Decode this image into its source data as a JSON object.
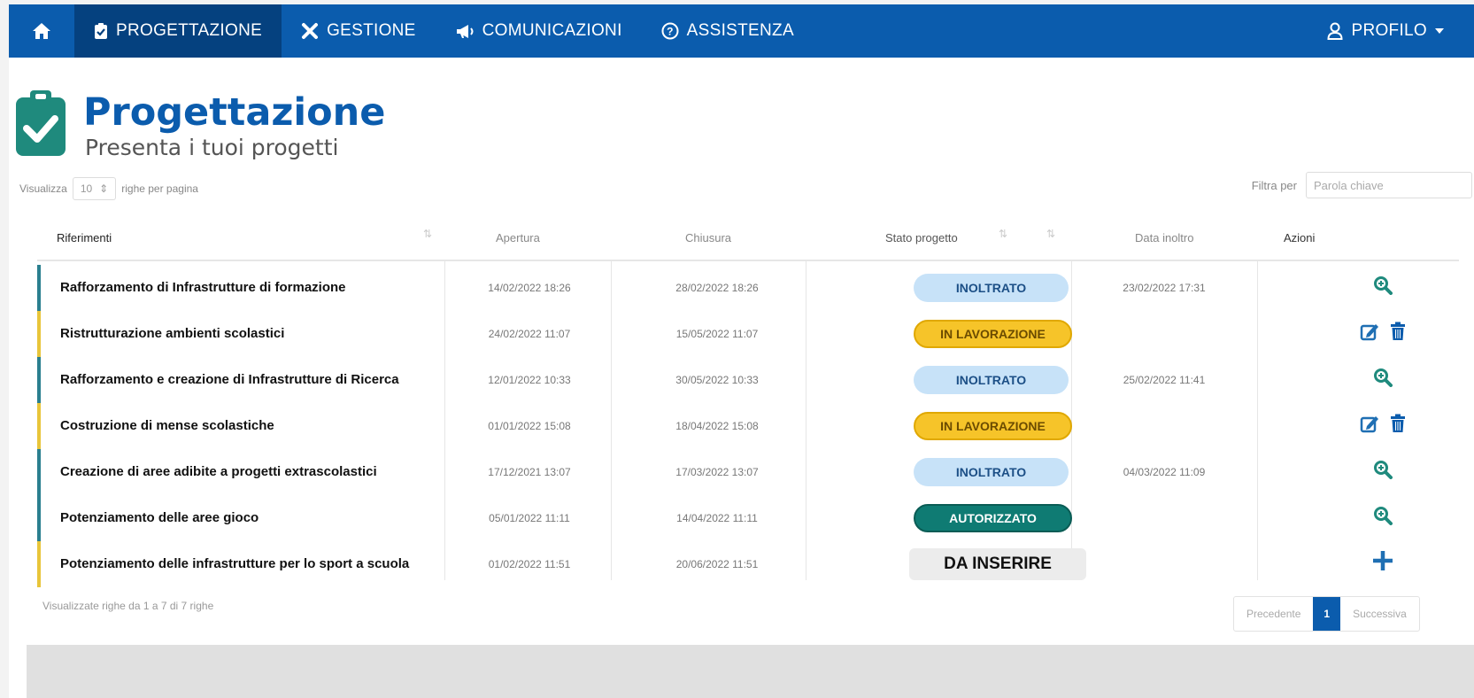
{
  "nav": {
    "items": [
      {
        "label": "PROGETTAZIONE",
        "icon": "clipboard-check-icon",
        "active": true
      },
      {
        "label": "GESTIONE",
        "icon": "tools-icon",
        "active": false
      },
      {
        "label": "COMUNICAZIONI",
        "icon": "megaphone-icon",
        "active": false
      },
      {
        "label": "ASSISTENZA",
        "icon": "help-circle-icon",
        "active": false
      }
    ],
    "profile_label": "PROFILO"
  },
  "header": {
    "title": "Progettazione",
    "subtitle": "Presenta i tuoi progetti"
  },
  "table_controls": {
    "show_label": "Visualizza",
    "page_size": "10",
    "rows_per_page_label": "righe per pagina",
    "filter_label": "Filtra per",
    "filter_placeholder": "Parola chiave"
  },
  "table": {
    "columns": [
      "Riferimenti",
      "Apertura",
      "Chiusura",
      "Stato progetto",
      "Data inoltro",
      "Azioni"
    ],
    "rows": [
      {
        "name": "Rafforzamento di Infrastrutture di formazione",
        "apertura": "14/02/2022 18:26",
        "chiusura": "28/02/2022 18:26",
        "stato": "INOLTRATO",
        "inoltro": "23/02/2022 17:31",
        "actions": [
          "view"
        ],
        "stripe": "#2a7f8f"
      },
      {
        "name": "Ristrutturazione ambienti scolastici",
        "apertura": "24/02/2022 11:07",
        "chiusura": "15/05/2022 11:07",
        "stato": "IN LAVORAZIONE",
        "inoltro": "",
        "actions": [
          "edit",
          "delete"
        ],
        "stripe": "#e8c53a"
      },
      {
        "name": "Rafforzamento e creazione di Infrastrutture di Ricerca",
        "apertura": "12/01/2022 10:33",
        "chiusura": "30/05/2022 10:33",
        "stato": "INOLTRATO",
        "inoltro": "25/02/2022 11:41",
        "actions": [
          "view"
        ],
        "stripe": "#2a7f8f"
      },
      {
        "name": "Costruzione di mense scolastiche",
        "apertura": "01/01/2022 15:08",
        "chiusura": "18/04/2022 15:08",
        "stato": "IN LAVORAZIONE",
        "inoltro": "",
        "actions": [
          "edit",
          "delete"
        ],
        "stripe": "#e8c53a"
      },
      {
        "name": "Creazione di aree adibite a progetti extrascolastici",
        "apertura": "17/12/2021 13:07",
        "chiusura": "17/03/2022 13:07",
        "stato": "INOLTRATO",
        "inoltro": "04/03/2022 11:09",
        "actions": [
          "view"
        ],
        "stripe": "#2a7f8f"
      },
      {
        "name": "Potenziamento delle aree gioco",
        "apertura": "05/01/2022 11:11",
        "chiusura": "14/04/2022 11:11",
        "stato": "AUTORIZZATO",
        "inoltro": "",
        "actions": [
          "view"
        ],
        "stripe": "#2a7f8f"
      },
      {
        "name": "Potenziamento delle infrastrutture per lo sport a scuola",
        "apertura": "01/02/2022 11:51",
        "chiusura": "20/06/2022 11:51",
        "stato": "DA INSERIRE",
        "inoltro": "",
        "actions": [
          "add"
        ],
        "stripe": "#e8c53a"
      }
    ]
  },
  "footer": {
    "summary": "Visualizzate righe da 1 a 7 di 7 righe",
    "prev_label": "Precedente",
    "page": "1",
    "next_label": "Successiva"
  },
  "colors": {
    "nav_bg": "#0b5cad",
    "nav_active": "#05417f",
    "brand_green": "#1f8a7d",
    "inoltrato": "#c7e2f8",
    "in_lavorazione": "#f6c429",
    "autorizzato": "#0f7b73"
  }
}
